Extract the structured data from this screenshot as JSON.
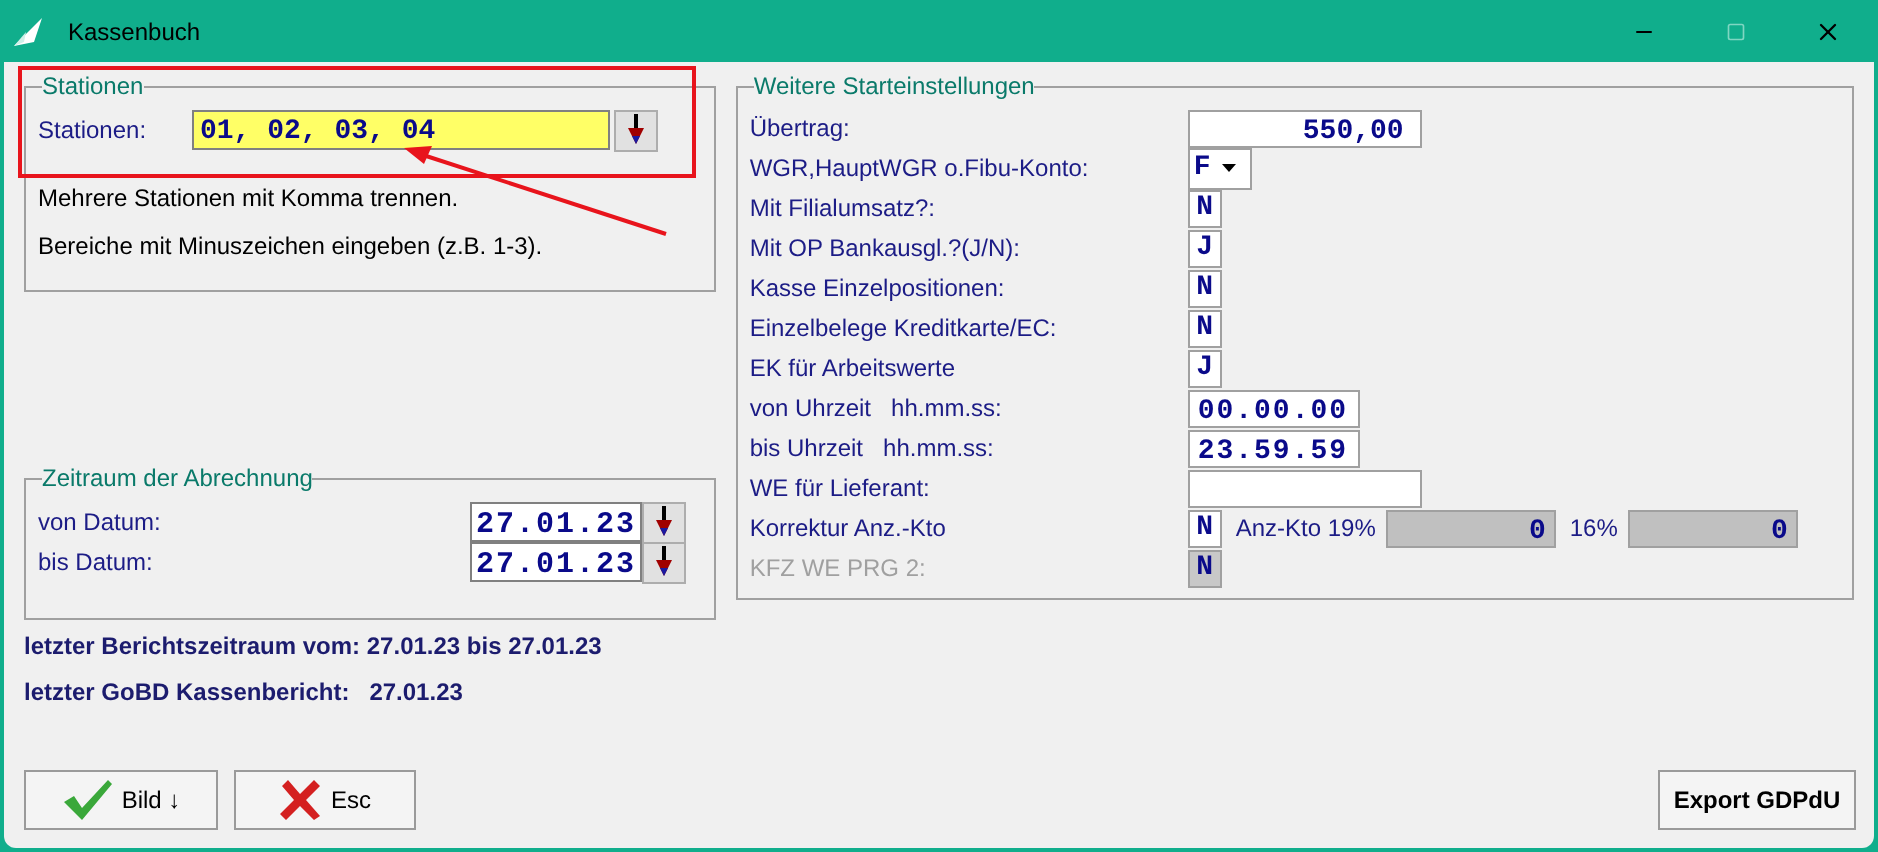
{
  "window": {
    "title": "Kassenbuch"
  },
  "stations": {
    "legend": "Stationen",
    "label": "Stationen:",
    "value": "01, 02, 03, 04",
    "hints": [
      "Mehrere Stationen mit Komma trennen.",
      "Bereiche mit Minuszeichen eingeben (z.B. 1-3)."
    ]
  },
  "period": {
    "legend": "Zeitraum der Abrechnung",
    "rows": [
      {
        "label": "von Datum:",
        "value": "27.01.23"
      },
      {
        "label": "bis Datum:",
        "value": "27.01.23"
      }
    ]
  },
  "info": [
    "letzter Berichtszeitraum vom: 27.01.23 bis 27.01.23",
    "letzter GoBD Kassenbericht:   27.01.23"
  ],
  "settings": {
    "legend": "Weitere Starteinstellungen",
    "rows": [
      {
        "kind": "amount",
        "label": "Übertrag:",
        "value": "550,00"
      },
      {
        "kind": "combo",
        "label": "WGR,HauptWGR o.Fibu-Konto:",
        "value": "F"
      },
      {
        "kind": "flag",
        "label": "Mit Filialumsatz?:",
        "value": "N",
        "disabled": false
      },
      {
        "kind": "flag",
        "label": "Mit OP Bankausgl.?(J/N):",
        "value": "J",
        "disabled": false
      },
      {
        "kind": "flag",
        "label": "Kasse Einzelpositionen:",
        "value": "N",
        "disabled": false
      },
      {
        "kind": "flag",
        "label": "Einzelbelege Kreditkarte/EC:",
        "value": "N",
        "disabled": false
      },
      {
        "kind": "flag",
        "label": "EK für Arbeitswerte",
        "value": "J",
        "disabled": false
      },
      {
        "kind": "time",
        "label": "von Uhrzeit   hh.mm.ss:",
        "value": "00.00.00"
      },
      {
        "kind": "time",
        "label": "bis Uhrzeit   hh.mm.ss:",
        "value": "23.59.59"
      },
      {
        "kind": "text",
        "label": "WE für Lieferant:",
        "value": ""
      },
      {
        "kind": "correction",
        "label": "Korrektur Anz.-Kto",
        "value": "N",
        "extras": [
          {
            "label": "Anz-Kto 19%",
            "value": "0"
          },
          {
            "label": "16%",
            "value": "0"
          }
        ]
      },
      {
        "kind": "flag",
        "label": "KFZ WE PRG 2:",
        "value": "N",
        "disabled": true
      }
    ]
  },
  "buttons": [
    {
      "label": "Bild ↓",
      "kind": "check"
    },
    {
      "label": "Esc",
      "kind": "cross"
    }
  ],
  "export_button": "Export GDPdU"
}
